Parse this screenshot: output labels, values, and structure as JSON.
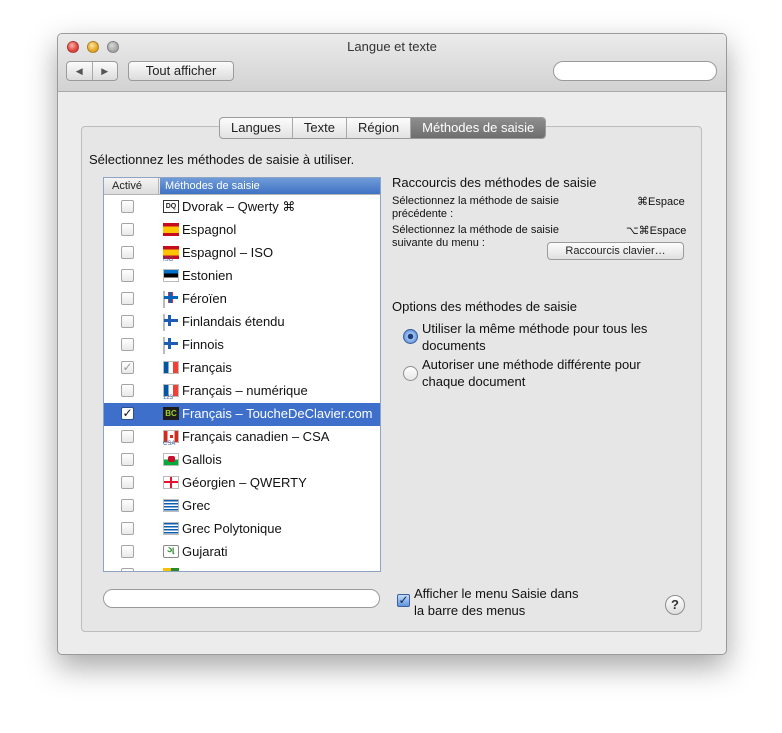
{
  "window": {
    "title": "Langue et texte"
  },
  "toolbar": {
    "back_label": "◀",
    "forward_label": "▶",
    "show_all_label": "Tout afficher",
    "search_placeholder": ""
  },
  "tabs": [
    {
      "label": "Langues"
    },
    {
      "label": "Texte"
    },
    {
      "label": "Région"
    },
    {
      "label": "Méthodes de saisie",
      "active": true
    }
  ],
  "left": {
    "instruction": "Sélectionnez les méthodes de saisie à utiliser.",
    "columns": {
      "active": "Activé",
      "methods": "Méthodes de saisie"
    },
    "rows": [
      {
        "label": "Dvorak – Qwerty ⌘",
        "checked": false,
        "icon": "dvorak-icon",
        "flag_text": "DQ"
      },
      {
        "label": "Espagnol",
        "checked": false,
        "icon": "flag-spain-icon"
      },
      {
        "label": "Espagnol – ISO",
        "checked": false,
        "icon": "flag-spain-iso-icon",
        "flag_sub": "ISO"
      },
      {
        "label": "Estonien",
        "checked": false,
        "icon": "flag-estonia-icon"
      },
      {
        "label": "Féroïen",
        "checked": false,
        "icon": "flag-faroe-icon"
      },
      {
        "label": "Finlandais étendu",
        "checked": false,
        "icon": "flag-finland-extended-icon"
      },
      {
        "label": "Finnois",
        "checked": false,
        "icon": "flag-finland-icon"
      },
      {
        "label": "Français",
        "checked": true,
        "dim": true,
        "icon": "flag-france-icon"
      },
      {
        "label": "Français – numérique",
        "checked": false,
        "icon": "flag-france-numeric-icon",
        "flag_sub": "123"
      },
      {
        "label": "Français – ToucheDeClavier.com",
        "checked": true,
        "selected": true,
        "icon": "touchedeclavier-icon",
        "flag_text": "BC"
      },
      {
        "label": "Français canadien – CSA",
        "checked": false,
        "icon": "flag-canada-csa-icon",
        "flag_sub": "CSA"
      },
      {
        "label": "Gallois",
        "checked": false,
        "icon": "flag-wales-icon"
      },
      {
        "label": "Géorgien – QWERTY",
        "checked": false,
        "icon": "flag-georgia-icon"
      },
      {
        "label": "Grec",
        "checked": false,
        "icon": "flag-greece-icon"
      },
      {
        "label": "Grec Polytonique",
        "checked": false,
        "icon": "flag-greece-polytonic-icon"
      },
      {
        "label": "Gujarati",
        "checked": false,
        "icon": "gujarati-icon",
        "flag_text": "ગ"
      },
      {
        "label": "",
        "checked": false,
        "icon": "partial-row-icon"
      }
    ],
    "search_placeholder": ""
  },
  "shortcuts": {
    "title": "Raccourcis des méthodes de saisie",
    "previous_line1": "Sélectionnez la méthode de saisie",
    "previous_line2": "précédente :",
    "previous_key": "⌘Espace",
    "next_line1": "Sélectionnez la méthode de saisie",
    "next_line2": "suivante du menu :",
    "next_key": "⌥⌘Espace",
    "button_label": "Raccourcis clavier…"
  },
  "options": {
    "title": "Options des méthodes de saisie",
    "same_line1": "Utiliser la même méthode pour tous les",
    "same_line2": "documents",
    "different_line1": "Autoriser une méthode différente pour",
    "different_line2": "chaque document",
    "selected": "same"
  },
  "menu_option": {
    "line1": "Afficher le menu Saisie dans",
    "line2": "la barre des menus",
    "checked": true
  },
  "help_label": "?"
}
